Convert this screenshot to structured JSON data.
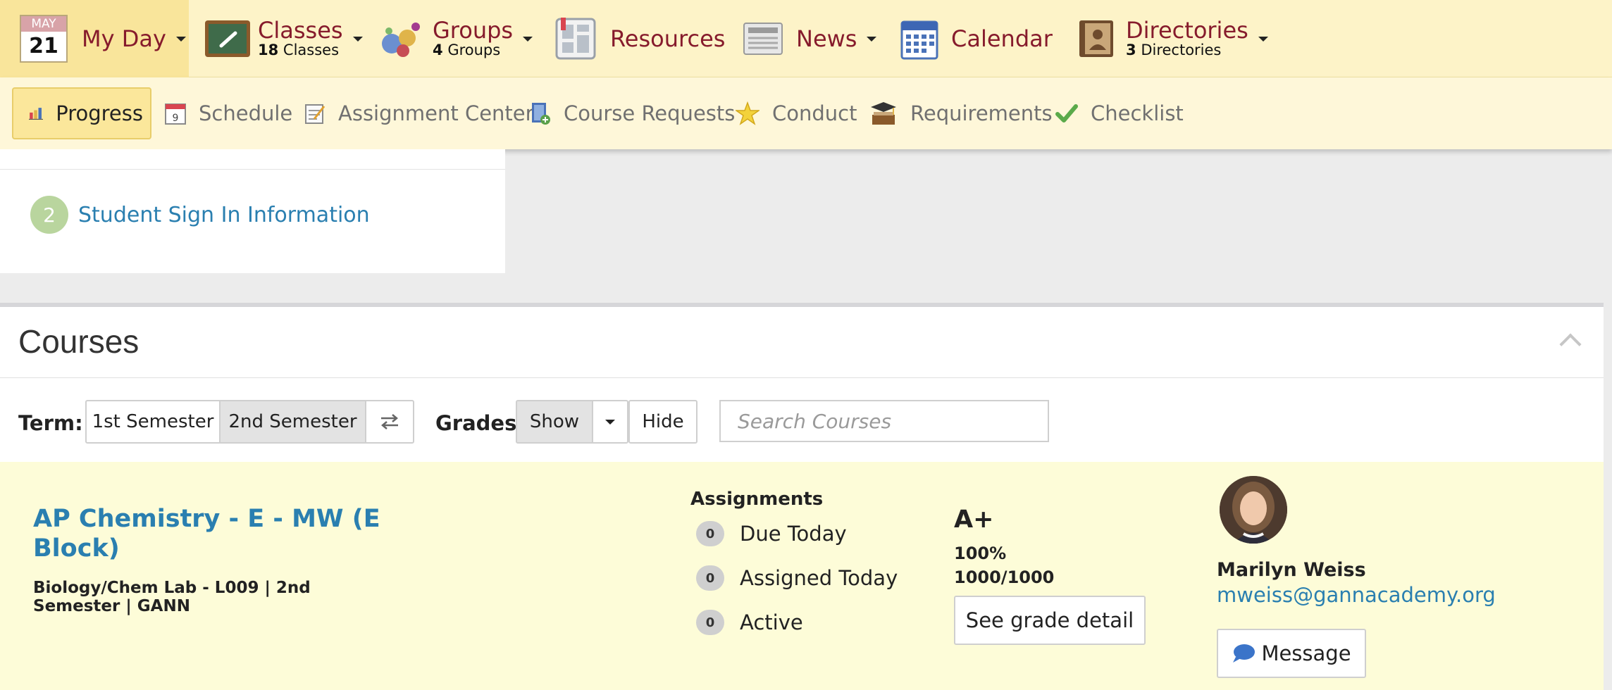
{
  "top_nav": {
    "my_day": {
      "month": "MAY",
      "day": "21",
      "label": "My Day"
    },
    "classes": {
      "label": "Classes",
      "count": "18",
      "sub": "Classes"
    },
    "groups": {
      "label": "Groups",
      "count": "4",
      "sub": "Groups"
    },
    "resources": {
      "label": "Resources"
    },
    "news": {
      "label": "News"
    },
    "calendar": {
      "label": "Calendar"
    },
    "directories": {
      "label": "Directories",
      "count": "3",
      "sub": "Directories"
    }
  },
  "sub_nav": {
    "items": [
      {
        "label": "Progress",
        "icon": "bar-chart-icon"
      },
      {
        "label": "Schedule",
        "icon": "calendar-page-icon"
      },
      {
        "label": "Assignment Center",
        "icon": "notepad-icon"
      },
      {
        "label": "Course Requests",
        "icon": "book-plus-icon"
      },
      {
        "label": "Conduct",
        "icon": "star-icon"
      },
      {
        "label": "Requirements",
        "icon": "graduation-cap-icon"
      },
      {
        "label": "Checklist",
        "icon": "checkmark-icon"
      }
    ]
  },
  "sign_in": {
    "number": "2",
    "label": "Student Sign In Information"
  },
  "courses": {
    "title": "Courses",
    "term_label": "Term:",
    "terms": [
      "1st Semester",
      "2nd Semester"
    ],
    "grades_label": "Grades:",
    "show_label": "Show",
    "hide_label": "Hide",
    "search_placeholder": "Search Courses",
    "course": {
      "title": "AP Chemistry - E - MW (E Block)",
      "meta": "Biology/Chem Lab - L009 | 2nd Semester | GANN",
      "assignments_heading": "Assignments",
      "assignments": [
        {
          "count": "0",
          "label": "Due Today"
        },
        {
          "count": "0",
          "label": "Assigned Today"
        },
        {
          "count": "0",
          "label": "Active"
        }
      ],
      "grade_letter": "A+",
      "grade_percent": "100%",
      "grade_points": "1000/1000",
      "grade_button": "See grade detail",
      "teacher_name": "Marilyn Weiss",
      "teacher_email": "mweiss@gannacademy.org",
      "message_button": "Message"
    }
  },
  "colors": {
    "nav_bg": "#fdf3c8",
    "nav_text": "#861b2c",
    "link": "#2a7fb0",
    "course_row_bg": "#fdfcd8"
  }
}
